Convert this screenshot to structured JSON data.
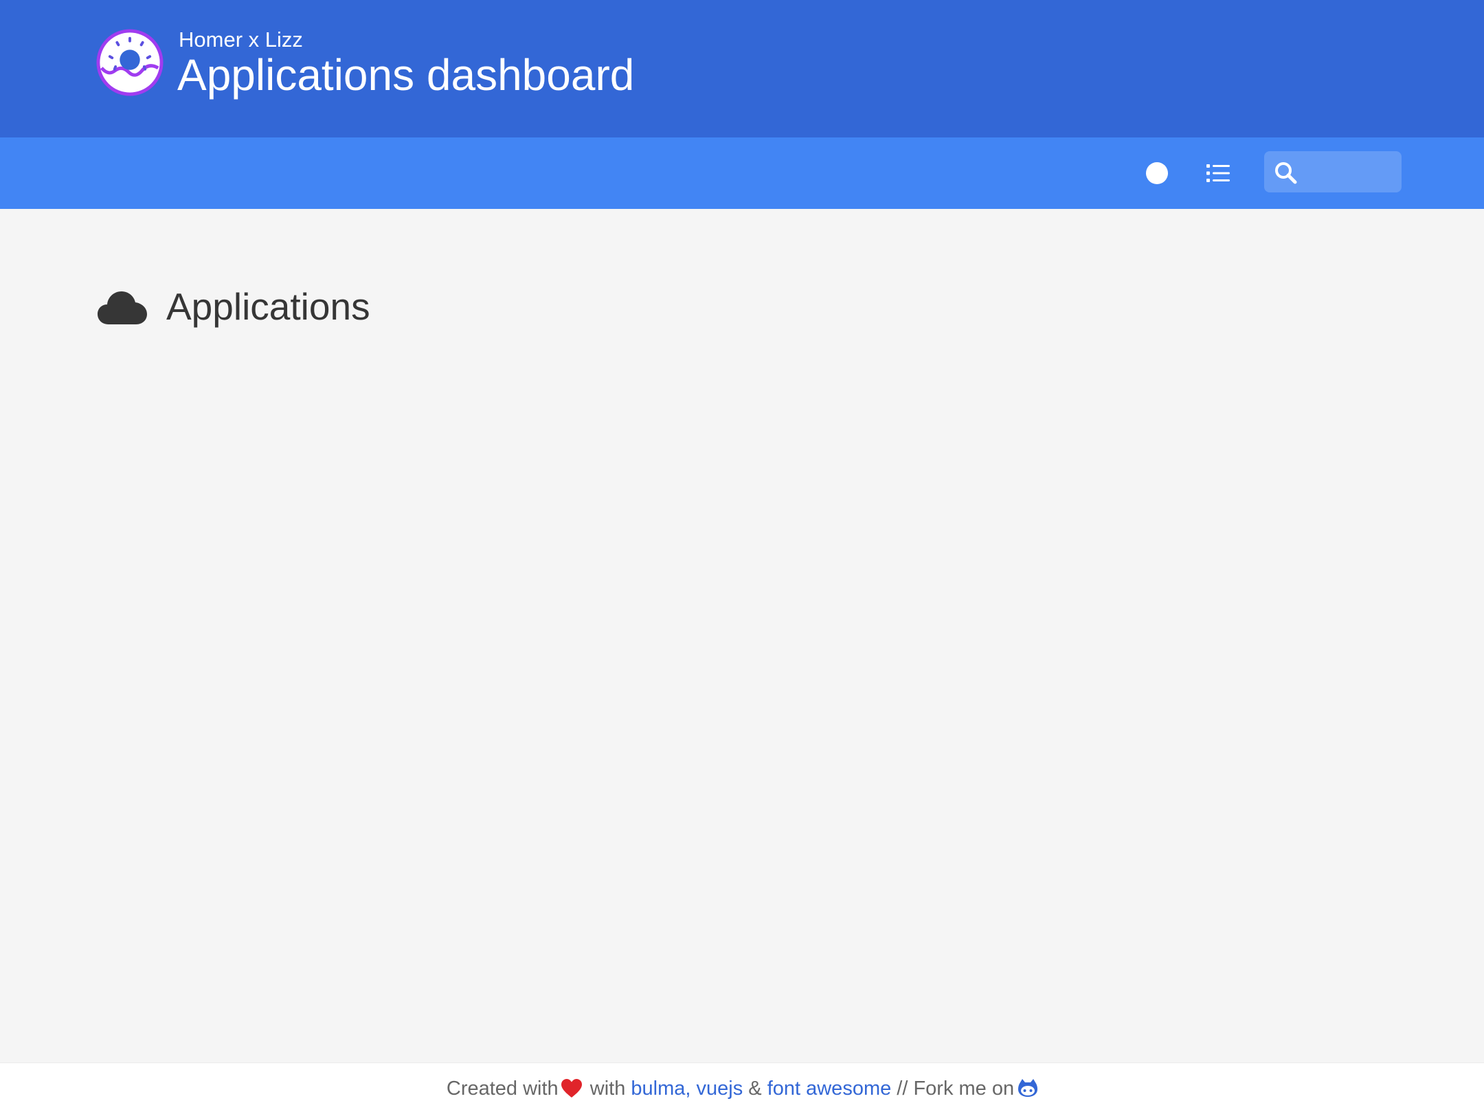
{
  "header": {
    "subtitle": "Homer x Lizz",
    "title": "Applications dashboard",
    "logo_icon": "donut-logo-icon"
  },
  "navbar": {
    "theme_icon": "circle-icon",
    "layout_icon": "list-icon",
    "search_icon": "search-icon",
    "search_value": "",
    "search_placeholder": ""
  },
  "main": {
    "groups": [
      {
        "icon": "cloud-icon",
        "title": "Applications"
      }
    ]
  },
  "footer": {
    "created_with": "Created with",
    "heart_icon": "heart-icon",
    "with": "with",
    "bulma": "bulma",
    "comma": ",",
    "vuejs": "vuejs",
    "amp": "&",
    "font_awesome": "font awesome",
    "fork": "// Fork me on",
    "github_icon": "github-icon"
  },
  "colors": {
    "header_bg": "#3367d6",
    "navbar_bg": "#4285f4",
    "page_bg": "#f5f5f5",
    "link": "#3367d6",
    "text": "#363636"
  }
}
